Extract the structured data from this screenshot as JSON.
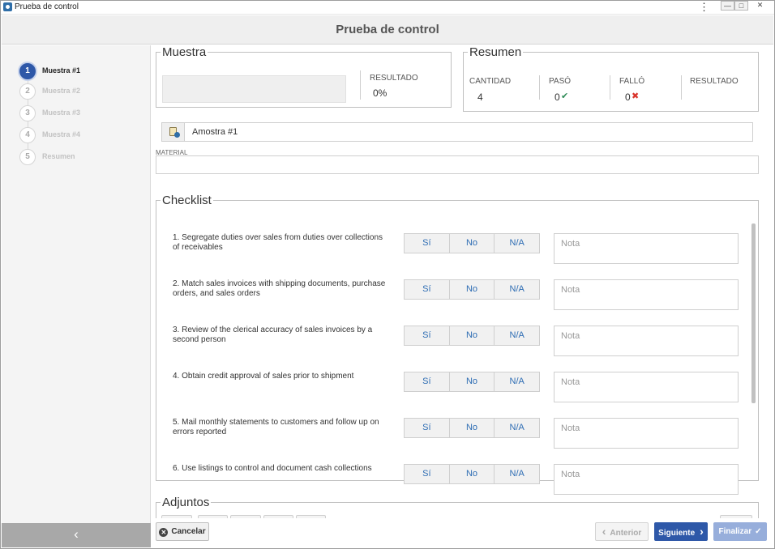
{
  "window": {
    "title": "Prueba de control",
    "menu_glyph": "⋮",
    "minimize_glyph": "—",
    "maximize_glyph": "□",
    "close_glyph": "✕"
  },
  "header": {
    "title": "Prueba de control"
  },
  "sidebar": {
    "steps": [
      {
        "num": "1",
        "label": "Muestra #1",
        "active": true
      },
      {
        "num": "2",
        "label": "Muestra #2",
        "active": false
      },
      {
        "num": "3",
        "label": "Muestra #3",
        "active": false
      },
      {
        "num": "4",
        "label": "Muestra #4",
        "active": false
      },
      {
        "num": "5",
        "label": "Resumen",
        "active": false
      }
    ],
    "collapse_glyph": "‹"
  },
  "muestra": {
    "title": "Muestra",
    "resultado_label": "RESULTADO",
    "resultado_value": "0%"
  },
  "resumen": {
    "title": "Resumen",
    "cantidad_label": "CANTIDAD",
    "cantidad_value": "4",
    "paso_label": "PASÓ",
    "paso_value": "0",
    "paso_glyph": "✔",
    "fallo_label": "FALLÓ",
    "fallo_value": "0",
    "fallo_glyph": "✖",
    "resultado_label": "RESULTADO"
  },
  "sample_name": "Amostra #1",
  "material": {
    "label": "MATERIAL",
    "value": ""
  },
  "checklist": {
    "title": "Checklist",
    "options": {
      "yes": "Sí",
      "no": "No",
      "na": "N/A"
    },
    "note_placeholder": "Nota",
    "items": [
      {
        "text": "1. Segregate duties over sales from duties over collections of receivables"
      },
      {
        "text": "2. Match sales invoices with shipping documents, purchase orders, and sales orders"
      },
      {
        "text": "3. Review of the clerical accuracy of sales invoices by a second person"
      },
      {
        "text": "4. Obtain credit approval of sales prior to shipment"
      },
      {
        "text": "5. Mail monthly statements to customers and follow up on errors reported"
      },
      {
        "text": "6. Use listings to control and document cash collections"
      }
    ]
  },
  "adjuntos": {
    "title": "Adjuntos"
  },
  "footer": {
    "cancel_label": "Cancelar",
    "cancel_glyph": "✕",
    "prev_label": "Anterior",
    "prev_glyph": "‹",
    "next_label": "Siguiente",
    "next_glyph": "›",
    "finish_label": "Finalizar",
    "finish_glyph": "✓"
  },
  "colors": {
    "primary": "#2e58a8",
    "link": "#2e6db4",
    "success": "#2e8b57",
    "danger": "#d9342b"
  }
}
